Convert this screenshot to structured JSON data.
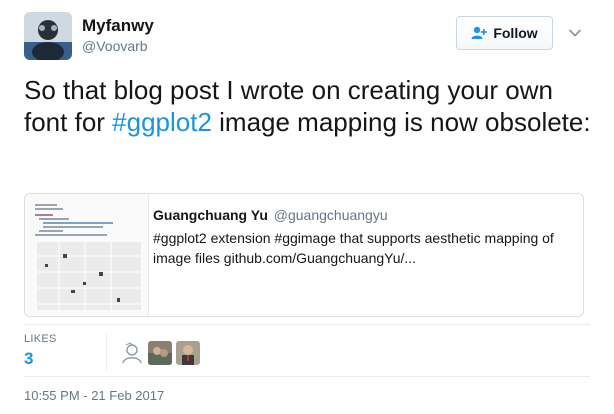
{
  "user": {
    "display_name": "Myfanwy",
    "handle": "@Voovarb",
    "avatar_icon": "user-avatar-icon"
  },
  "follow_button": {
    "label": "Follow",
    "icon": "add-user-icon"
  },
  "tweet": {
    "text_before": "So that blog post I wrote on creating your own font for ",
    "hashtag": "#ggplot2",
    "text_after": " image mapping is now obsolete:"
  },
  "card": {
    "author_name": "Guangchuang Yu",
    "author_handle": "@guangchuangyu",
    "text": "#ggplot2 extension #ggimage that supports aesthetic mapping of image files github.com/GuangchuangYu/..."
  },
  "likes": {
    "label": "LIKES",
    "count": "3"
  },
  "timestamp": "10:55 PM - 21 Feb 2017",
  "colors": {
    "link": "#1b95e0",
    "text": "#14171a",
    "muted": "#657786"
  }
}
